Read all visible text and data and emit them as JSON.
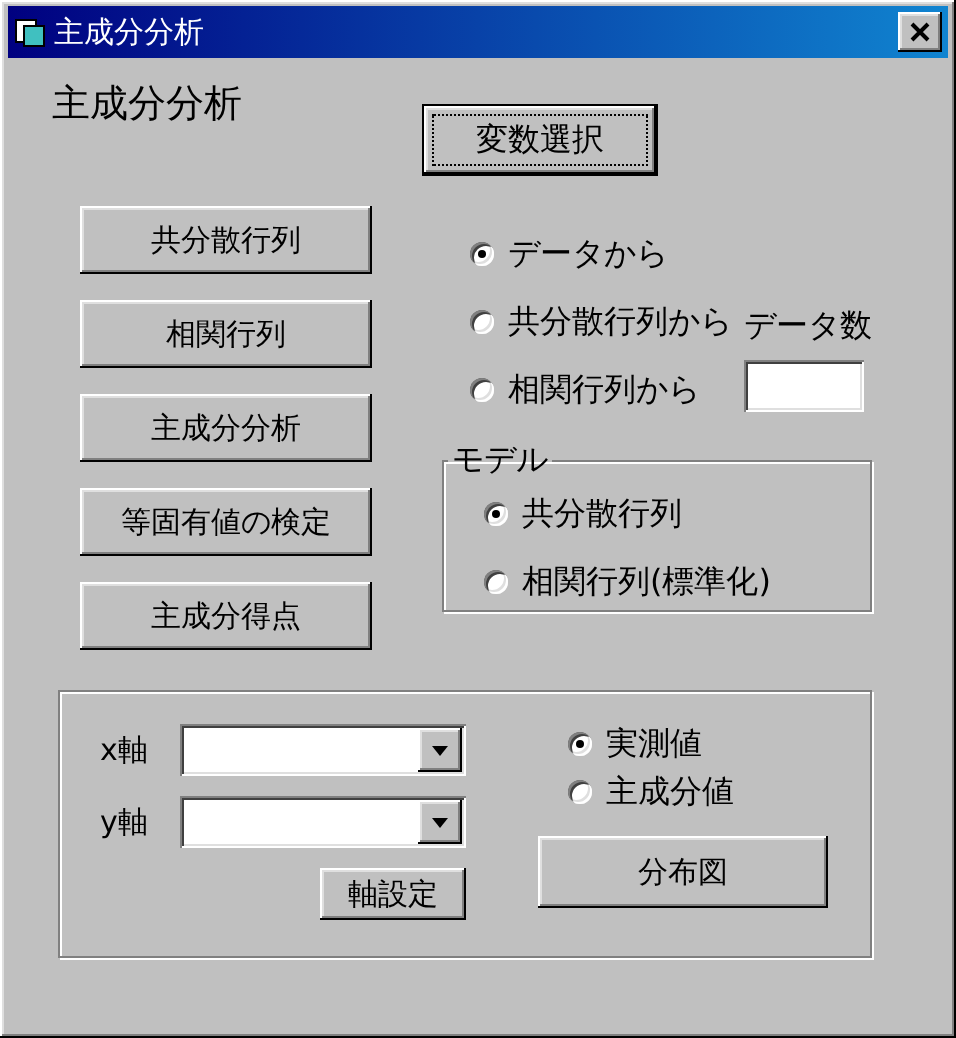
{
  "window": {
    "title": "主成分分析"
  },
  "heading": "主成分分析",
  "select_button": "変数選択",
  "actions": [
    "共分散行列",
    "相関行列",
    "主成分分析",
    "等固有値の検定",
    "主成分得点"
  ],
  "source_options": [
    {
      "label": "データから",
      "selected": true
    },
    {
      "label": "共分散行列から",
      "selected": false
    },
    {
      "label": "相関行列から",
      "selected": false
    }
  ],
  "data_count_label": "データ数",
  "model": {
    "title": "モデル",
    "options": [
      {
        "label": "共分散行列",
        "selected": true
      },
      {
        "label": "相関行列(標準化)",
        "selected": false
      }
    ]
  },
  "plot": {
    "axes": [
      {
        "label": "x軸"
      },
      {
        "label": "y軸"
      }
    ],
    "axis_button": "軸設定",
    "value_options": [
      {
        "label": "実測値",
        "selected": true
      },
      {
        "label": "主成分値",
        "selected": false
      }
    ],
    "plot_button": "分布図"
  }
}
